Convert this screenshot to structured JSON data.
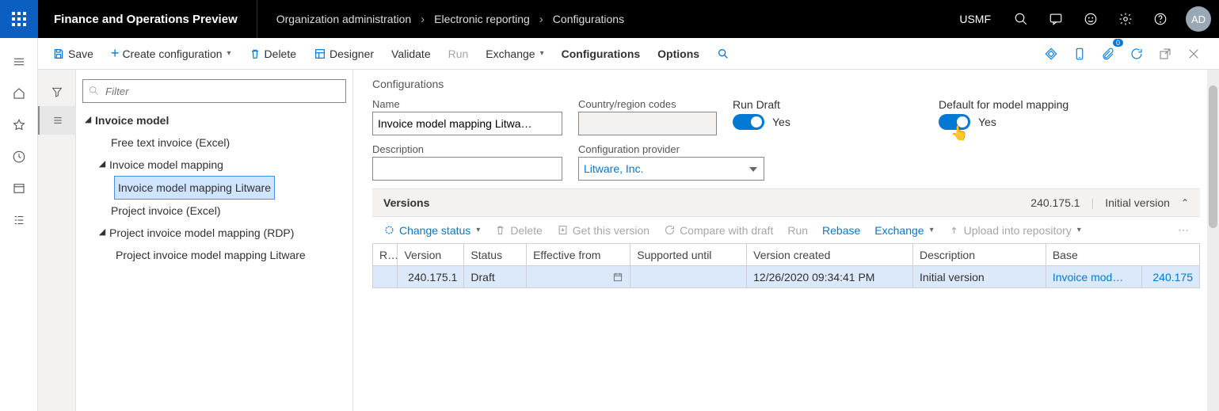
{
  "topbar": {
    "app_title": "Finance and Operations Preview",
    "breadcrumb": [
      "Organization administration",
      "Electronic reporting",
      "Configurations"
    ],
    "company": "USMF",
    "avatar": "AD"
  },
  "actionbar": {
    "save": "Save",
    "create": "Create configuration",
    "delete": "Delete",
    "designer": "Designer",
    "validate": "Validate",
    "run": "Run",
    "exchange": "Exchange",
    "configurations": "Configurations",
    "options": "Options",
    "badge_count": "0"
  },
  "tree": {
    "filter_placeholder": "Filter",
    "nodes": {
      "root": "Invoice model",
      "n1": "Free text invoice (Excel)",
      "n2": "Invoice model mapping",
      "n3": "Invoice model mapping Litware",
      "n4": "Project invoice (Excel)",
      "n5": "Project invoice model mapping (RDP)",
      "n6": "Project invoice model mapping Litware"
    }
  },
  "details": {
    "section_title": "Configurations",
    "labels": {
      "name": "Name",
      "country": "Country/region codes",
      "run_draft": "Run Draft",
      "default_mapping": "Default for model mapping",
      "description": "Description",
      "provider": "Configuration provider"
    },
    "values": {
      "name": "Invoice model mapping Litwa…",
      "country": "",
      "description": "",
      "provider": "Litware, Inc.",
      "run_draft_text": "Yes",
      "default_mapping_text": "Yes"
    }
  },
  "versions": {
    "title": "Versions",
    "header_version": "240.175.1",
    "header_desc": "Initial version",
    "toolbar": {
      "change_status": "Change status",
      "delete": "Delete",
      "get_version": "Get this version",
      "compare": "Compare with draft",
      "run": "Run",
      "rebase": "Rebase",
      "exchange": "Exchange",
      "upload": "Upload into repository"
    },
    "columns": {
      "r": "R…",
      "version": "Version",
      "status": "Status",
      "effective": "Effective from",
      "supported": "Supported until",
      "created": "Version created",
      "description": "Description",
      "base": "Base"
    },
    "rows": [
      {
        "r": "",
        "version": "240.175.1",
        "status": "Draft",
        "effective": "",
        "supported": "",
        "created": "12/26/2020 09:34:41 PM",
        "description": "Initial version",
        "base_name": "Invoice mod…",
        "base_ver": "240.175"
      }
    ]
  }
}
